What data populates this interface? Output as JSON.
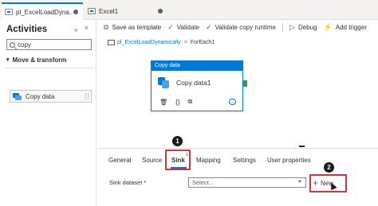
{
  "tabs": [
    {
      "label": "pl_ExcelLoadDyna..."
    },
    {
      "label": "Excel1"
    }
  ],
  "activities": {
    "title": "Activities",
    "collapse_glyph": "«",
    "menu_glyph": "˅",
    "search_value": "copy",
    "group_label": "Move & transform",
    "item_label": "Copy data"
  },
  "toolbar": {
    "save_template": "Save as template",
    "validate": "Validate",
    "validate_copy": "Validate copy runtime",
    "debug": "Debug",
    "add_trigger": "Add trigger"
  },
  "breadcrumb": {
    "pipeline": "pl_ExcelLoadDynamically",
    "separator": ">",
    "current": "ForEach1"
  },
  "activity_box": {
    "header": "Copy data",
    "name": "Copy data1"
  },
  "panel_tabs": [
    {
      "label": "General"
    },
    {
      "label": "Source"
    },
    {
      "label": "Sink"
    },
    {
      "label": "Mapping"
    },
    {
      "label": "Settings"
    },
    {
      "label": "User properties"
    }
  ],
  "sink_tab_superscript": "1",
  "sink_dataset": {
    "label": "Sink dataset *",
    "placeholder": "Select...",
    "new_button": "New"
  },
  "annotations": {
    "step1": "1",
    "step2": "2"
  },
  "colors": {
    "accent": "#0078d4",
    "highlight": "#d13438",
    "port": "#3a9b3a"
  }
}
